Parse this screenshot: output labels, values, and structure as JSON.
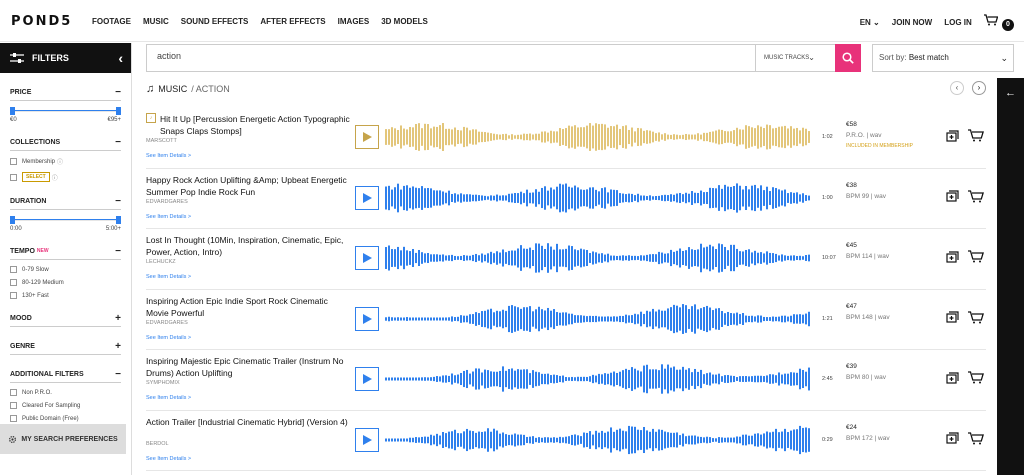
{
  "nav": {
    "logo": "POND5",
    "links": [
      "FOOTAGE",
      "MUSIC",
      "SOUND EFFECTS",
      "AFTER EFFECTS",
      "IMAGES",
      "3D MODELS"
    ],
    "lang": "EN",
    "join": "JOIN NOW",
    "login": "LOG IN",
    "cart_count": "0"
  },
  "sidebar": {
    "title": "FILTERS",
    "price": {
      "label": "PRICE",
      "min": "€0",
      "max": "€95+"
    },
    "collections": {
      "label": "COLLECTIONS",
      "membership": "Membership",
      "select": "SELECT"
    },
    "duration": {
      "label": "DURATION",
      "min": "0:00",
      "max": "5:00+"
    },
    "tempo": {
      "label": "TEMPO",
      "badge": "NEW",
      "options": [
        "0-79 Slow",
        "80-129 Medium",
        "130+ Fast"
      ]
    },
    "mood": {
      "label": "MOOD"
    },
    "genre": {
      "label": "GENRE"
    },
    "additional": {
      "label": "ADDITIONAL FILTERS",
      "options": [
        "Non P.R.O.",
        "Cleared For Sampling",
        "Public Domain (Free)"
      ]
    },
    "prefs": "MY SEARCH PREFERENCES"
  },
  "search": {
    "query": "action",
    "type": "MUSIC TRACKS"
  },
  "sort": {
    "label": "Sort by:",
    "value": "Best match"
  },
  "breadcrumb": {
    "section": "MUSIC",
    "sub": "/ ACTION"
  },
  "colors": {
    "accent": "#e8327a",
    "wave_blue": "#2f80ed",
    "wave_gold": "#e3c67a"
  },
  "tracks": [
    {
      "title": "Hit It Up [Percussion Energetic Action Typographic Snaps Claps Stomps]",
      "artist": "MARSCOTT",
      "details": "See Item Details >",
      "duration": "1:02",
      "price": "€58",
      "meta": "P.R.O. | wav",
      "membership": "INCLUDED IN MEMBERSHIP",
      "gold": true
    },
    {
      "title": "Happy Rock Action Uplifting &Amp; Upbeat Energetic Summer Pop Indie Rock Fun",
      "artist": "EDVARDGARES",
      "details": "See Item Details >",
      "duration": "1:00",
      "price": "€38",
      "meta": "BPM 99 | wav",
      "membership": "",
      "gold": false
    },
    {
      "title": "Lost In Thought (10Min, Inspiration, Cinematic, Epic, Power, Action, Intro)",
      "artist": "LECHUCKZ",
      "details": "See Item Details >",
      "duration": "10:07",
      "price": "€45",
      "meta": "BPM 114 | wav",
      "membership": "",
      "gold": false
    },
    {
      "title": "Inspiring Action Epic Indie Sport Rock Cinematic Movie Powerful",
      "artist": "EDVARDGARES",
      "details": "See Item Details >",
      "duration": "1:21",
      "price": "€47",
      "meta": "BPM 148 | wav",
      "membership": "",
      "gold": false
    },
    {
      "title": "Inspiring Majestic Epic Cinematic Trailer (Instrum No Drums) Action Uplifting",
      "artist": "SYMPHOMIX",
      "details": "See Item Details >",
      "duration": "2:45",
      "price": "€39",
      "meta": "BPM 80 | wav",
      "membership": "",
      "gold": false
    },
    {
      "title": "Action Trailer [Industrial Cinematic Hybrid] (Version 4)",
      "artist": "BERDOL",
      "details": "See Item Details >",
      "duration": "0:29",
      "price": "€24",
      "meta": "BPM 172 | wav",
      "membership": "",
      "gold": false
    }
  ]
}
